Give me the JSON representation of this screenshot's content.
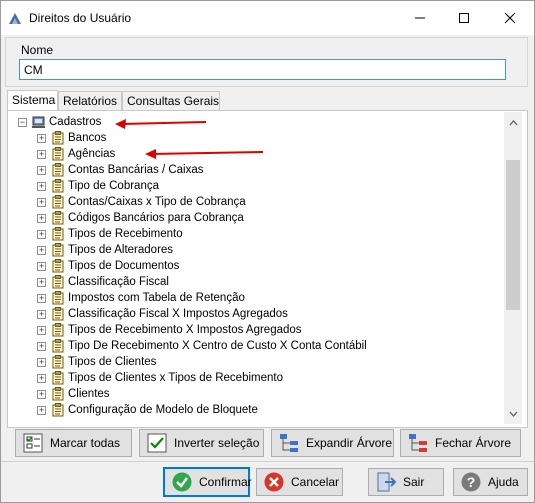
{
  "window": {
    "title": "Direitos do Usuário",
    "icon": "app-icon",
    "controls": [
      "minimize-icon",
      "maximize-icon",
      "close-icon"
    ]
  },
  "nome": {
    "label": "Nome",
    "value": "CM"
  },
  "tabs": [
    {
      "label": "Sistema",
      "active": true
    },
    {
      "label": "Relatórios",
      "active": false
    },
    {
      "label": "Consultas Gerais",
      "active": false
    }
  ],
  "tree": {
    "root": {
      "label": "Cadastros",
      "expander": "⊟",
      "icon": "computer-icon"
    },
    "items": [
      {
        "label": "Bancos"
      },
      {
        "label": "Agências"
      },
      {
        "label": "Contas Bancárias / Caixas"
      },
      {
        "label": "Tipo de Cobrança"
      },
      {
        "label": "Contas/Caixas x Tipo de Cobrança"
      },
      {
        "label": "Códigos Bancários para Cobrança"
      },
      {
        "label": "Tipos de Recebimento"
      },
      {
        "label": "Tipos de Alteradores"
      },
      {
        "label": "Tipos de Documentos"
      },
      {
        "label": "Classificação Fiscal"
      },
      {
        "label": "Impostos com Tabela de Retenção"
      },
      {
        "label": "Classificação Fiscal X Impostos Agregados"
      },
      {
        "label": "Tipos de Recebimento X Impostos Agregados"
      },
      {
        "label": "Tipo De Recebimento X Centro de Custo X Conta Contábil"
      },
      {
        "label": "Tipos de Clientes"
      },
      {
        "label": "Tipos de Clientes x Tipos de Recebimento"
      },
      {
        "label": "Clientes"
      },
      {
        "label": "Configuração de Modelo de Bloquete"
      }
    ],
    "item_expander": "⊞",
    "item_icon": "clipboard-icon"
  },
  "actions": {
    "mark_all": "Marcar todas",
    "invert": "Inverter seleção",
    "expand": "Expandir Árvore",
    "collapse": "Fechar Árvore"
  },
  "footer": {
    "confirm": "Confirmar",
    "cancel": "Cancelar",
    "exit": "Sair",
    "help": "Ajuda"
  },
  "annotations": {
    "arrow_color": "#e00000"
  }
}
